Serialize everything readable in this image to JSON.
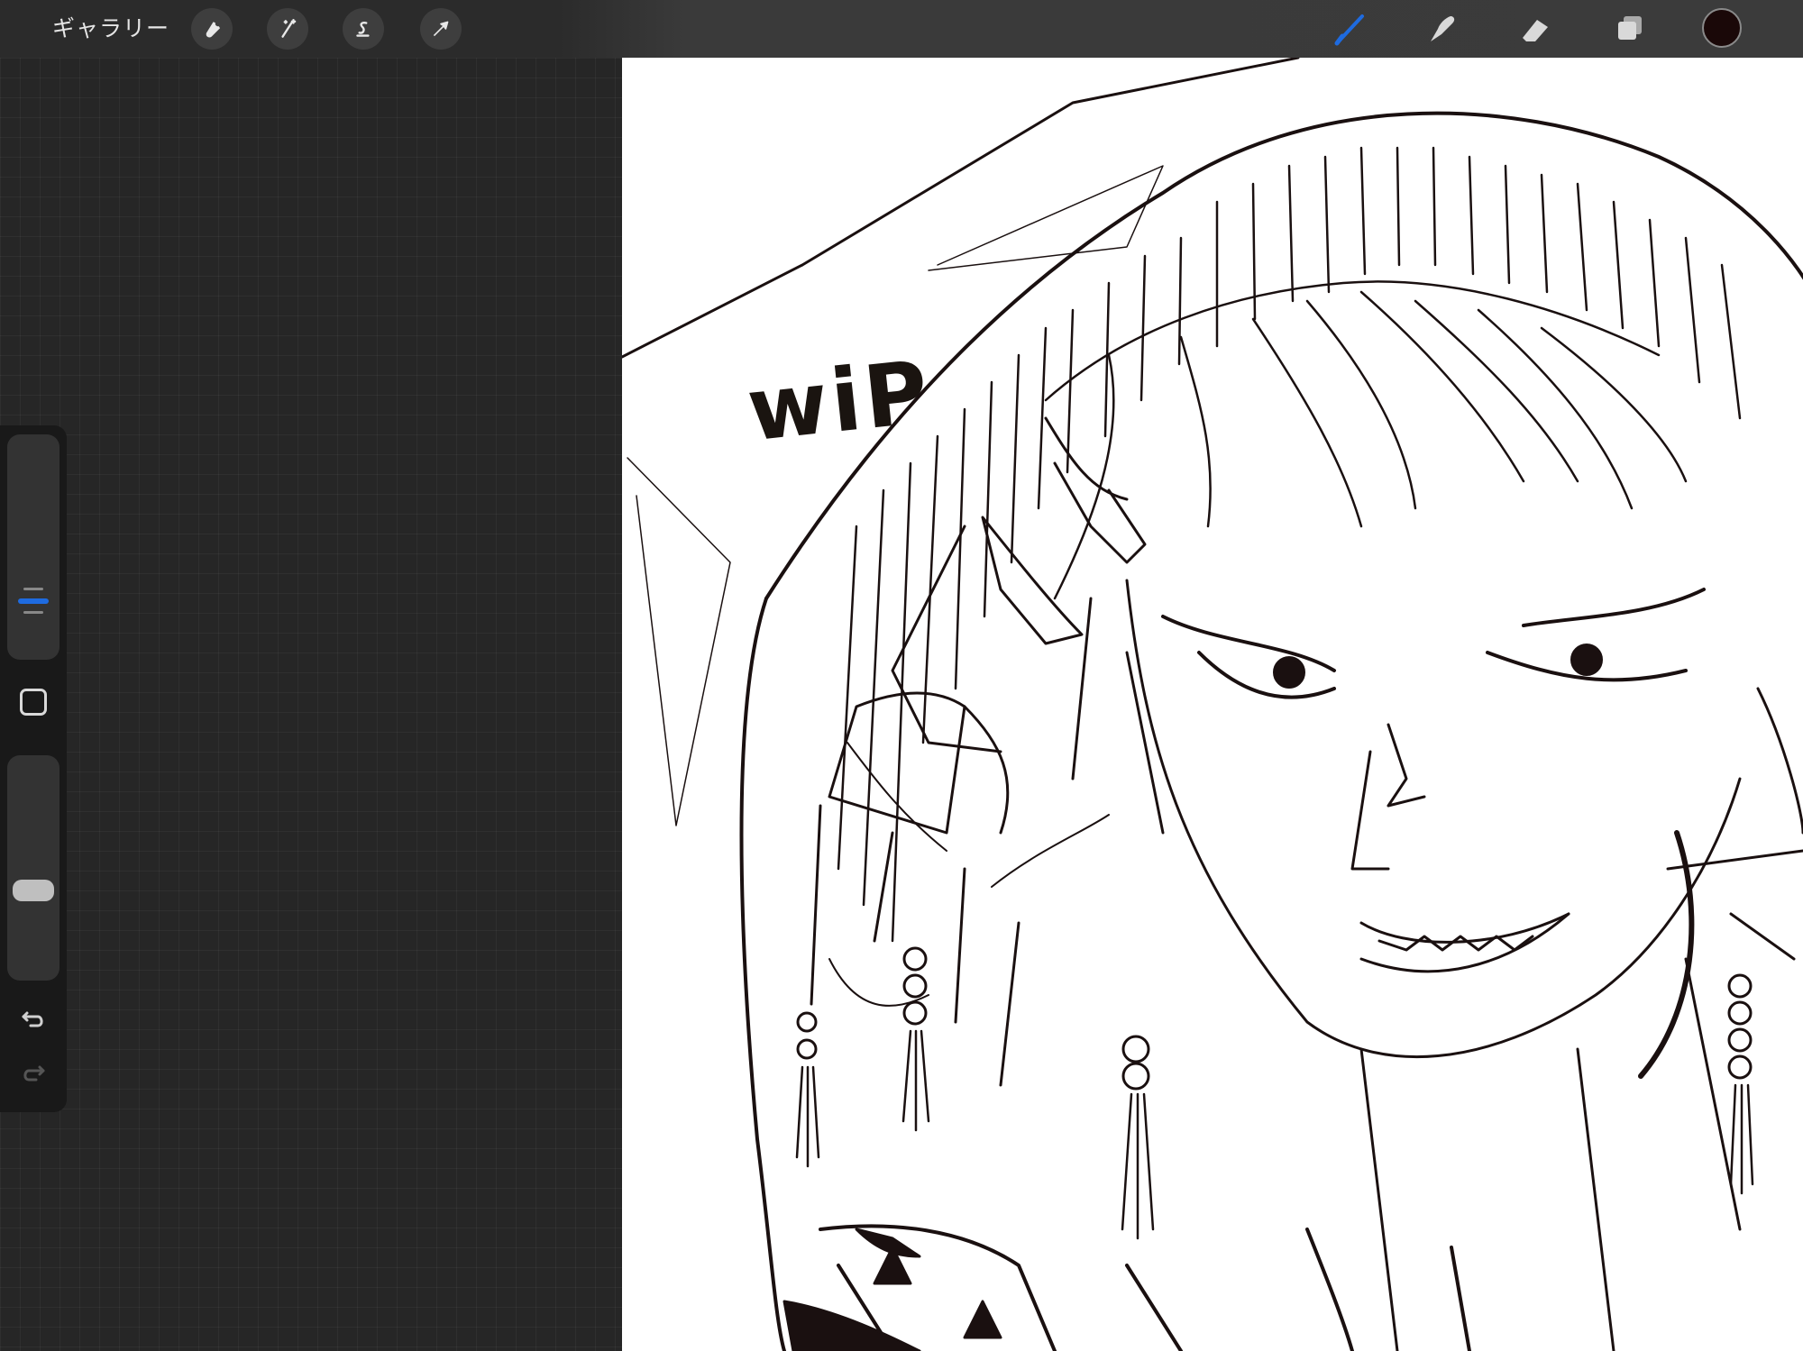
{
  "toolbar": {
    "gallery_label": "ギャラリー",
    "left_tools": [
      {
        "name": "actions",
        "icon": "wrench-icon"
      },
      {
        "name": "adjustments",
        "icon": "magic-wand-icon"
      },
      {
        "name": "selection",
        "icon": "selection-s-icon"
      },
      {
        "name": "transform",
        "icon": "arrow-cursor-icon"
      }
    ],
    "right_tools": [
      {
        "name": "brush",
        "icon": "brush-icon",
        "active": true
      },
      {
        "name": "smudge",
        "icon": "smudge-finger-icon"
      },
      {
        "name": "eraser",
        "icon": "eraser-icon"
      },
      {
        "name": "layers",
        "icon": "layers-icon"
      }
    ],
    "active_color": "#1a0808",
    "active_tool_color": "#1e6be0"
  },
  "sidebar": {
    "brush_size_icon": "slider-handle-icon",
    "opacity_icon": "slider-handle-icon",
    "modify_icon": "square-icon",
    "undo_icon": "undo-arrow-icon",
    "redo_icon": "redo-arrow-icon",
    "redo_enabled": false
  },
  "canvas": {
    "annotation_text": "wiP",
    "content": "line-art-sketch"
  }
}
